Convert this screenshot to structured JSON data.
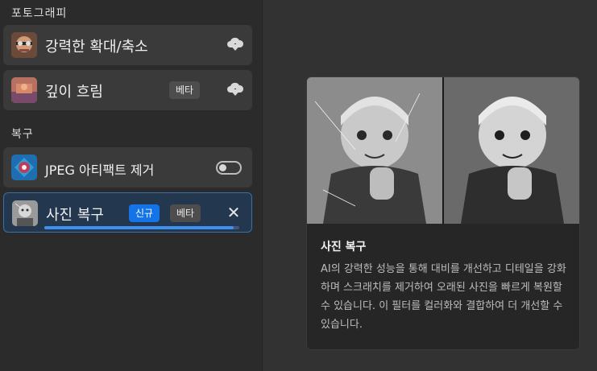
{
  "sections": {
    "photography_title": "포토그래피",
    "restoration_title": "복구"
  },
  "filters": {
    "super_zoom": {
      "label": "강력한 확대/축소",
      "icon": "cloud-download-icon"
    },
    "depth_blur": {
      "label": "깊이 흐림",
      "badge": "베타",
      "icon": "cloud-download-icon"
    },
    "jpeg_artifact": {
      "label": "JPEG 아티팩트 제거",
      "enabled": false
    },
    "photo_restoration": {
      "label": "사진 복구",
      "badge_new": "신규",
      "badge_beta": "베타",
      "progress_percent": 97,
      "icon": "close-icon"
    }
  },
  "info": {
    "title": "사진 복구",
    "description": "AI의 강력한 성능을 통해 대비를 개선하고 디테일을 강화하며 스크래치를 제거하여 오래된 사진을 빠르게 복원할 수 있습니다. 이 필터를 컬러화와 결합하여 더 개선할 수 있습니다."
  },
  "colors": {
    "accent": "#1473e6",
    "selected_bg": "#23374f",
    "progress": "#3f8ff0"
  }
}
